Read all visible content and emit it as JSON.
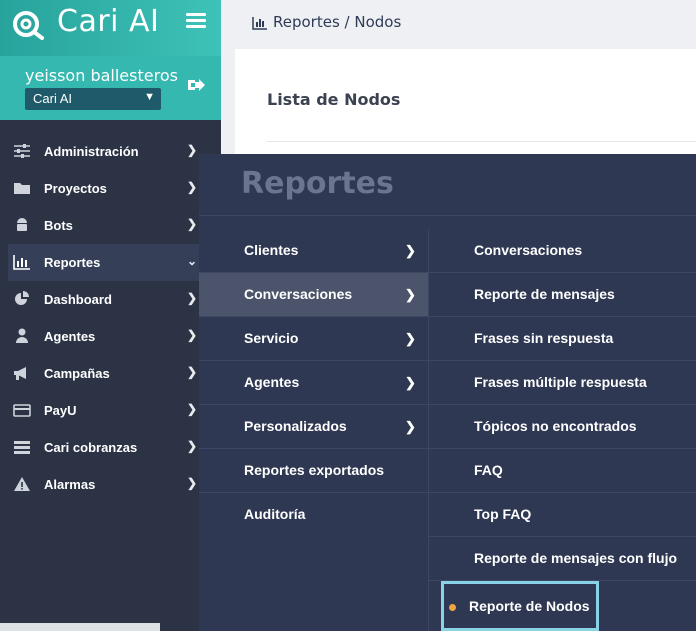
{
  "brand": {
    "name": "Cari AI"
  },
  "user": {
    "name": "yeisson ballesteros",
    "workspace": "Cari AI"
  },
  "sidebar": {
    "items": [
      {
        "label": "Administración",
        "icon": "sliders-icon"
      },
      {
        "label": "Proyectos",
        "icon": "folder-icon"
      },
      {
        "label": "Bots",
        "icon": "android-icon"
      },
      {
        "label": "Reportes",
        "icon": "bar-chart-icon"
      },
      {
        "label": "Dashboard",
        "icon": "pie-chart-icon"
      },
      {
        "label": "Agentes",
        "icon": "user-icon"
      },
      {
        "label": "Campañas",
        "icon": "megaphone-icon"
      },
      {
        "label": "PayU",
        "icon": "credit-card-icon"
      },
      {
        "label": "Cari cobranzas",
        "icon": "list-icon"
      },
      {
        "label": "Alarmas",
        "icon": "warning-icon"
      }
    ]
  },
  "breadcrumb": {
    "text": "Reportes / Nodos"
  },
  "page": {
    "title": "Lista de Nodos"
  },
  "mega": {
    "title": "Reportes",
    "categories": [
      {
        "label": "Clientes"
      },
      {
        "label": "Conversaciones"
      },
      {
        "label": "Servicio"
      },
      {
        "label": "Agentes"
      },
      {
        "label": "Personalizados"
      },
      {
        "label": "Reportes exportados"
      },
      {
        "label": "Auditoría"
      }
    ],
    "subitems": [
      {
        "label": "Conversaciones"
      },
      {
        "label": "Reporte de mensajes"
      },
      {
        "label": "Frases sin respuesta"
      },
      {
        "label": "Frases múltiple respuesta"
      },
      {
        "label": "Tópicos no encontrados"
      },
      {
        "label": "FAQ"
      },
      {
        "label": "Top FAQ"
      },
      {
        "label": "Reporte de mensajes con flujo"
      },
      {
        "label": "Reporte de Nodos"
      }
    ]
  },
  "colors": {
    "accent": "#34b8af",
    "sidebar": "#2b3345",
    "mega": "#2f3852",
    "selected_dot": "#f0a545",
    "highlight": "#8ad2e6"
  }
}
